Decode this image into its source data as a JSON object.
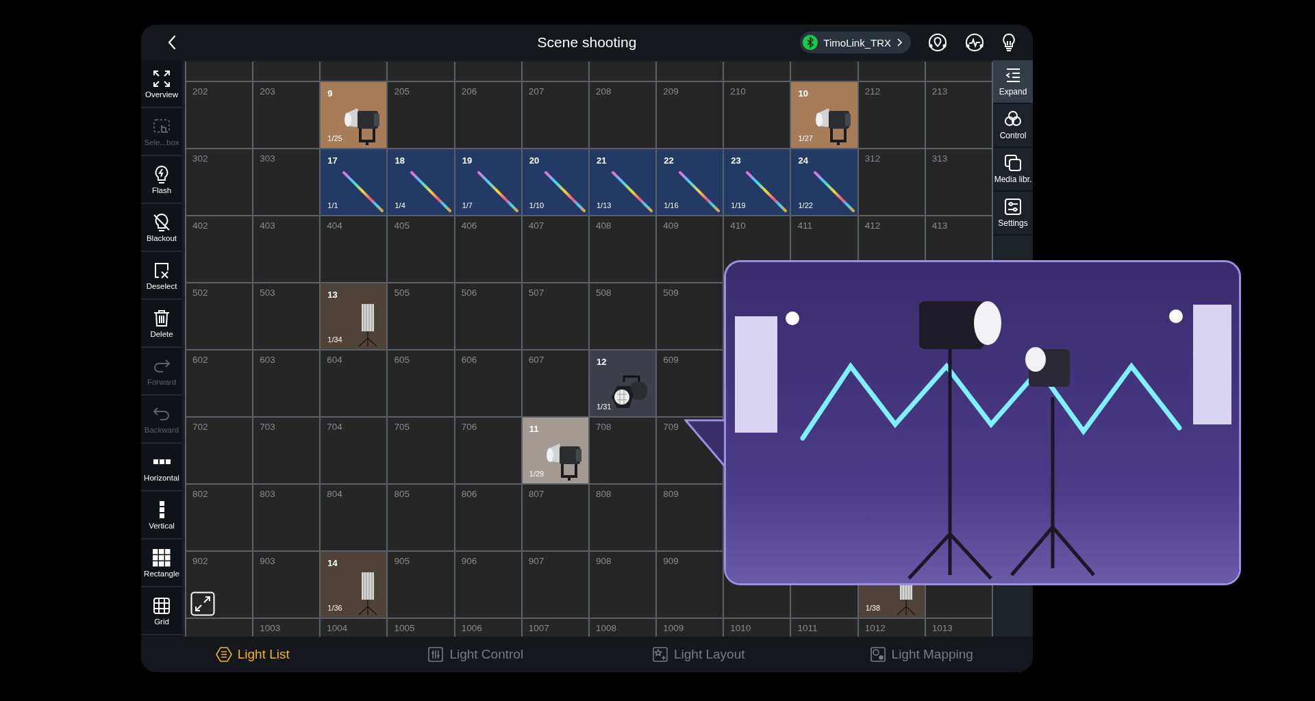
{
  "header": {
    "title": "Scene shooting",
    "device": "TimoLink_TRX"
  },
  "tools": [
    {
      "label": "Overview",
      "disabled": false
    },
    {
      "label": "Sele...box",
      "disabled": true
    },
    {
      "label": "Flash",
      "disabled": false
    },
    {
      "label": "Blackout",
      "disabled": false
    },
    {
      "label": "Deselect",
      "disabled": false
    },
    {
      "label": "Delete",
      "disabled": false
    },
    {
      "label": "Forward",
      "disabled": true
    },
    {
      "label": "Backward",
      "disabled": true
    },
    {
      "label": "Horizontal",
      "disabled": false
    },
    {
      "label": "Vertical",
      "disabled": false
    },
    {
      "label": "Rectangle",
      "disabled": false
    },
    {
      "label": "Grid",
      "disabled": false
    }
  ],
  "grid": {
    "rows": [
      {
        "cells": [
          {
            "kind": "empty"
          },
          {
            "kind": "empty"
          },
          {
            "kind": "empty"
          },
          {
            "kind": "empty"
          },
          {
            "kind": "empty"
          },
          {
            "kind": "empty"
          },
          {
            "kind": "empty"
          },
          {
            "kind": "empty"
          },
          {
            "kind": "empty"
          },
          {
            "kind": "empty"
          },
          {
            "kind": "empty"
          },
          {
            "kind": "empty"
          }
        ]
      },
      {
        "cells": [
          {
            "kind": "empty",
            "label": "202"
          },
          {
            "kind": "empty",
            "label": "203"
          },
          {
            "kind": "spot",
            "number": "9",
            "slot": "1/25",
            "color": "#a77c58"
          },
          {
            "kind": "empty",
            "label": "205"
          },
          {
            "kind": "empty",
            "label": "206"
          },
          {
            "kind": "empty",
            "label": "207"
          },
          {
            "kind": "empty",
            "label": "208"
          },
          {
            "kind": "empty",
            "label": "209"
          },
          {
            "kind": "empty",
            "label": "210"
          },
          {
            "kind": "spot",
            "number": "10",
            "slot": "1/27",
            "color": "#a77c58"
          },
          {
            "kind": "empty",
            "label": "212"
          },
          {
            "kind": "empty",
            "label": "213"
          }
        ]
      },
      {
        "cells": [
          {
            "kind": "empty",
            "label": "302"
          },
          {
            "kind": "empty",
            "label": "303"
          },
          {
            "kind": "tube",
            "number": "17",
            "slot": "1/1",
            "color": "#223a64"
          },
          {
            "kind": "tube",
            "number": "18",
            "slot": "1/4",
            "color": "#223a64"
          },
          {
            "kind": "tube",
            "number": "19",
            "slot": "1/7",
            "color": "#223a64"
          },
          {
            "kind": "tube",
            "number": "20",
            "slot": "1/10",
            "color": "#223a64"
          },
          {
            "kind": "tube",
            "number": "21",
            "slot": "1/13",
            "color": "#223a64"
          },
          {
            "kind": "tube",
            "number": "22",
            "slot": "1/16",
            "color": "#223a64"
          },
          {
            "kind": "tube",
            "number": "23",
            "slot": "1/19",
            "color": "#223a64"
          },
          {
            "kind": "tube",
            "number": "24",
            "slot": "1/22",
            "color": "#223a64"
          },
          {
            "kind": "empty",
            "label": "312"
          },
          {
            "kind": "empty",
            "label": "313"
          }
        ]
      },
      {
        "cells": [
          {
            "kind": "empty",
            "label": "402"
          },
          {
            "kind": "empty",
            "label": "403"
          },
          {
            "kind": "empty",
            "label": "404"
          },
          {
            "kind": "empty",
            "label": "405"
          },
          {
            "kind": "empty",
            "label": "406"
          },
          {
            "kind": "empty",
            "label": "407"
          },
          {
            "kind": "empty",
            "label": "408"
          },
          {
            "kind": "empty",
            "label": "409"
          },
          {
            "kind": "empty",
            "label": "410"
          },
          {
            "kind": "empty",
            "label": "411"
          },
          {
            "kind": "empty",
            "label": "412"
          },
          {
            "kind": "empty",
            "label": "413"
          }
        ]
      },
      {
        "cells": [
          {
            "kind": "empty",
            "label": "502"
          },
          {
            "kind": "empty",
            "label": "503"
          },
          {
            "kind": "panel",
            "number": "13",
            "slot": "1/34",
            "color": "#4f4239"
          },
          {
            "kind": "empty",
            "label": "505"
          },
          {
            "kind": "empty",
            "label": "506"
          },
          {
            "kind": "empty",
            "label": "507"
          },
          {
            "kind": "empty",
            "label": "508"
          },
          {
            "kind": "empty",
            "label": "509"
          },
          {
            "kind": "empty"
          },
          {
            "kind": "empty"
          },
          {
            "kind": "empty"
          },
          {
            "kind": "empty"
          }
        ]
      },
      {
        "cells": [
          {
            "kind": "empty",
            "label": "602"
          },
          {
            "kind": "empty",
            "label": "603"
          },
          {
            "kind": "empty",
            "label": "604"
          },
          {
            "kind": "empty",
            "label": "605"
          },
          {
            "kind": "empty",
            "label": "606"
          },
          {
            "kind": "empty",
            "label": "607"
          },
          {
            "kind": "par",
            "number": "12",
            "slot": "1/31",
            "color": "#3d4048"
          },
          {
            "kind": "empty",
            "label": "609"
          },
          {
            "kind": "empty"
          },
          {
            "kind": "empty"
          },
          {
            "kind": "empty"
          },
          {
            "kind": "empty"
          }
        ]
      },
      {
        "cells": [
          {
            "kind": "empty",
            "label": "702"
          },
          {
            "kind": "empty",
            "label": "703"
          },
          {
            "kind": "empty",
            "label": "704"
          },
          {
            "kind": "empty",
            "label": "705"
          },
          {
            "kind": "empty",
            "label": "706"
          },
          {
            "kind": "spot",
            "number": "11",
            "slot": "1/29",
            "color": "#a39a94"
          },
          {
            "kind": "empty",
            "label": "708"
          },
          {
            "kind": "empty",
            "label": "709"
          },
          {
            "kind": "empty"
          },
          {
            "kind": "empty"
          },
          {
            "kind": "empty"
          },
          {
            "kind": "empty"
          }
        ]
      },
      {
        "cells": [
          {
            "kind": "empty",
            "label": "802"
          },
          {
            "kind": "empty",
            "label": "803"
          },
          {
            "kind": "empty",
            "label": "804"
          },
          {
            "kind": "empty",
            "label": "805"
          },
          {
            "kind": "empty",
            "label": "806"
          },
          {
            "kind": "empty",
            "label": "807"
          },
          {
            "kind": "empty",
            "label": "808"
          },
          {
            "kind": "empty",
            "label": "809"
          },
          {
            "kind": "empty"
          },
          {
            "kind": "empty"
          },
          {
            "kind": "empty"
          },
          {
            "kind": "empty"
          }
        ]
      },
      {
        "cells": [
          {
            "kind": "empty",
            "label": "902"
          },
          {
            "kind": "empty",
            "label": "903"
          },
          {
            "kind": "panel",
            "number": "14",
            "slot": "1/36",
            "color": "#4f4239"
          },
          {
            "kind": "empty",
            "label": "905"
          },
          {
            "kind": "empty",
            "label": "906"
          },
          {
            "kind": "empty",
            "label": "907"
          },
          {
            "kind": "empty",
            "label": "908"
          },
          {
            "kind": "empty",
            "label": "909"
          },
          {
            "kind": "empty"
          },
          {
            "kind": "empty"
          },
          {
            "kind": "panel",
            "slot": "1/38",
            "color": "#4f4239"
          },
          {
            "kind": "empty"
          }
        ]
      },
      {
        "cells": [
          {
            "kind": "empty"
          },
          {
            "kind": "empty",
            "label": "1003"
          },
          {
            "kind": "empty",
            "label": "1004"
          },
          {
            "kind": "empty",
            "label": "1005"
          },
          {
            "kind": "empty",
            "label": "1006"
          },
          {
            "kind": "empty",
            "label": "1007"
          },
          {
            "kind": "empty",
            "label": "1008"
          },
          {
            "kind": "empty",
            "label": "1009"
          },
          {
            "kind": "empty",
            "label": "1010"
          },
          {
            "kind": "empty",
            "label": "1011"
          },
          {
            "kind": "empty",
            "label": "1012"
          },
          {
            "kind": "empty",
            "label": "1013"
          }
        ]
      }
    ]
  },
  "side_panel": [
    {
      "label": "Expand",
      "selected": true
    },
    {
      "label": "Control",
      "selected": false
    },
    {
      "label": "Media libr.",
      "selected": false
    },
    {
      "label": "Settings",
      "selected": false
    }
  ],
  "tabs": [
    {
      "label": "Light List",
      "selected": true
    },
    {
      "label": "Light Control",
      "selected": false
    },
    {
      "label": "Light Layout",
      "selected": false
    },
    {
      "label": "Light Mapping",
      "selected": false
    }
  ]
}
